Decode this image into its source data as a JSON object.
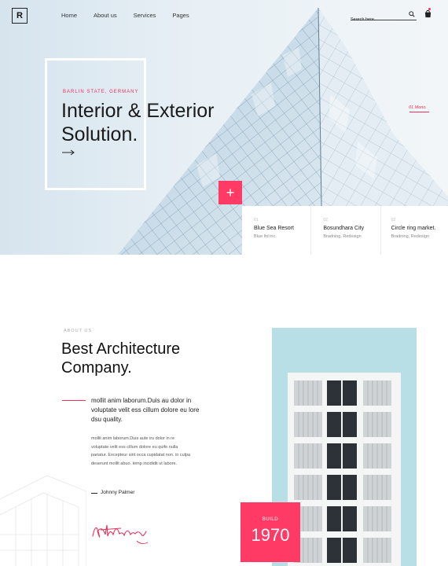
{
  "nav": {
    "logo_letter": "R",
    "items": [
      {
        "label": "Home"
      },
      {
        "label": "About us"
      },
      {
        "label": "Services"
      },
      {
        "label": "Pages"
      }
    ],
    "search_placeholder": "Search here.."
  },
  "hero": {
    "eyebrow": "BARLIN STATE, GERMANY",
    "title_line1": "Interior & Exterior",
    "title_line2": "Solution.",
    "slide_label": "01 Mono.",
    "plus_label": "+"
  },
  "projects": [
    {
      "number": "01",
      "title": "Blue Sea Resort",
      "tags": "Blue Itd inc."
    },
    {
      "number": "02",
      "title": "Bosundhara City",
      "tags": "Bradning, Redesign"
    },
    {
      "number": "03",
      "title": "Circle ring market.",
      "tags": "Bradning, Redesign"
    }
  ],
  "about": {
    "eyebrow": "ABOUT US",
    "title_line1": "Best Architecture",
    "title_line2": "Company.",
    "lead": "mollit anim laborum.Duis au dolor in voluptate velit ess cillum dolore eu lore dsu quality.",
    "body": "mollit anim laborum.Duis aute iru dolor in re voluptate velit ess cillum dolore eu quife nulla pariatur. Excepteur sint occa cupidatat non. in culpa deserunt mollit abuo. temp incididit ut labore.",
    "author": "Johnny Palmer"
  },
  "badge": {
    "label": "BUILD",
    "year": "1970"
  },
  "colors": {
    "accent": "#ff3a64",
    "hero_bg": "#e8f0f5",
    "panel_bg": "#b9dfe6"
  },
  "icons": [
    "search-icon",
    "cart-icon",
    "arrow-right-icon",
    "plus-icon"
  ]
}
